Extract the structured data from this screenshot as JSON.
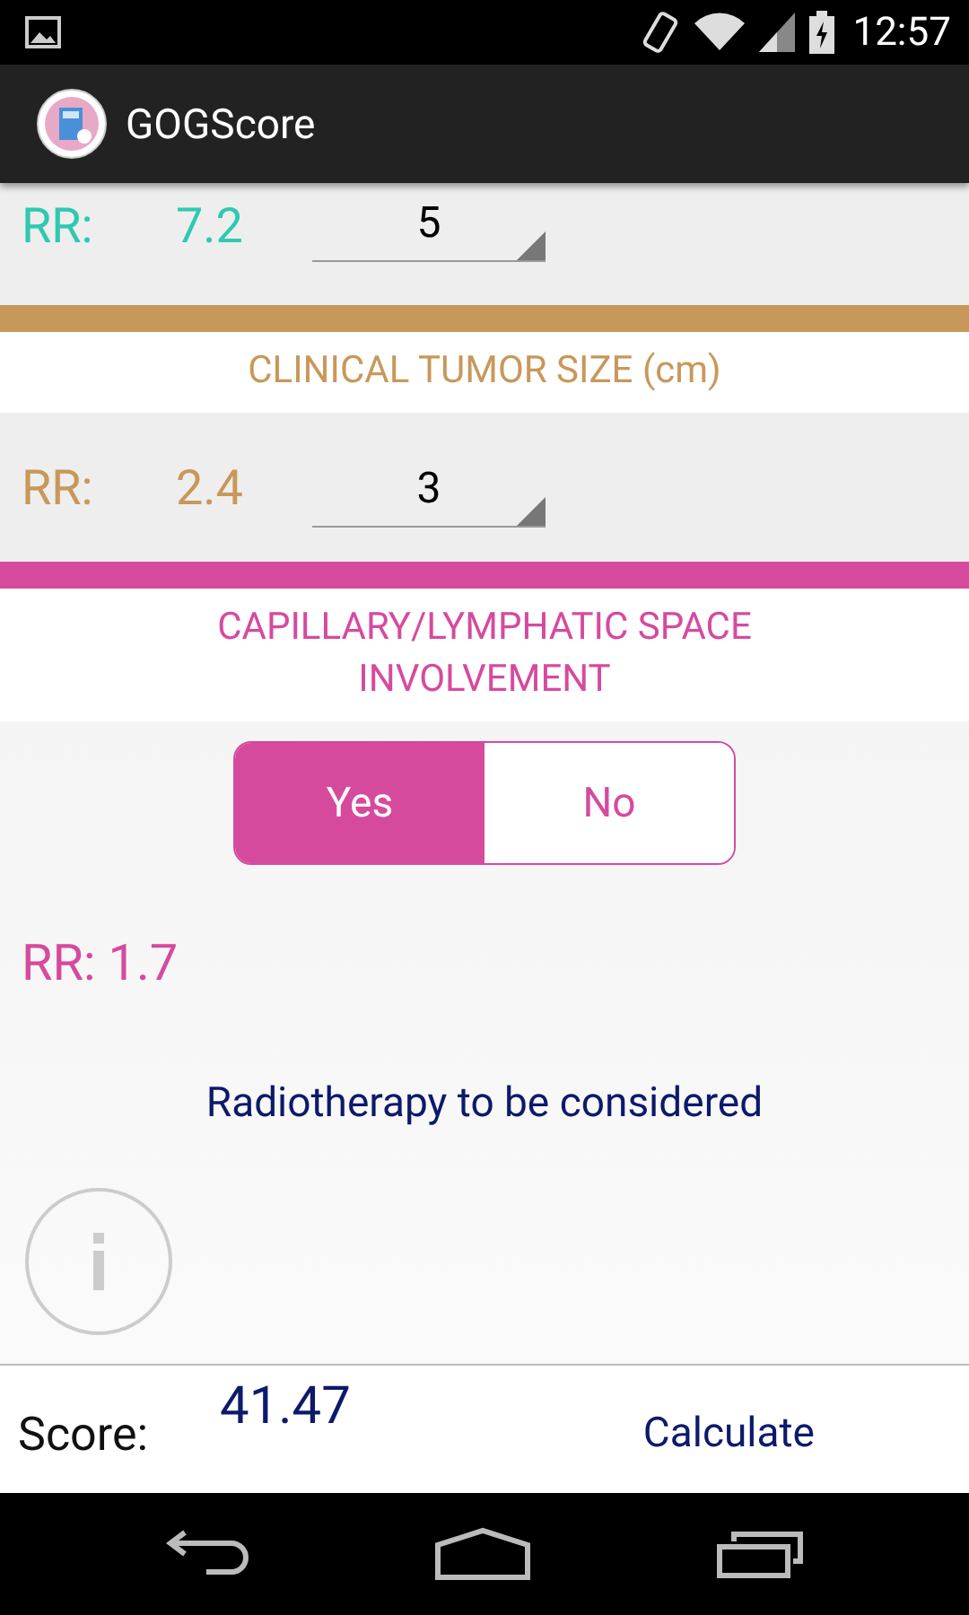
{
  "status_bar": {
    "time": "12:57"
  },
  "app_bar": {
    "title": "GOGScore"
  },
  "sections": [
    {
      "kind": "spinner",
      "color": "#2ec9b1",
      "rr_label": "RR:",
      "rr_value": "7.2",
      "value": "5"
    },
    {
      "kind": "spinner",
      "title": "CLINICAL TUMOR SIZE (cm)",
      "color": "#c8985a",
      "rr_label": "RR:",
      "rr_value": "2.4",
      "value": "3"
    },
    {
      "kind": "toggle",
      "title": "CAPILLARY/LYMPHATIC SPACE INVOLVEMENT",
      "color": "#d64a9e",
      "options": [
        {
          "label": "Yes",
          "selected": true
        },
        {
          "label": "No",
          "selected": false
        }
      ],
      "rr": "RR: 1.7"
    }
  ],
  "message": "Radiotherapy to be considered",
  "footer": {
    "score_label": "Score:",
    "score_value": "41.47",
    "button": "Calculate"
  }
}
